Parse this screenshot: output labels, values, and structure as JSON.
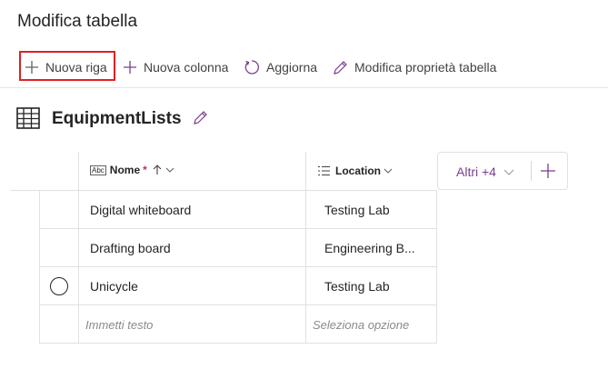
{
  "page": {
    "title": "Modifica tabella"
  },
  "toolbar": {
    "new_row": "Nuova riga",
    "new_column": "Nuova colonna",
    "refresh": "Aggiorna",
    "edit_props": "Modifica proprietà tabella"
  },
  "table": {
    "name": "EquipmentLists",
    "columns": [
      {
        "label": "Nome",
        "required_mark": "*",
        "type_icon": "text-type-icon",
        "type_text": "Abc"
      },
      {
        "label": "Location",
        "type_icon": "choice-type-icon"
      }
    ],
    "more_columns": "Altri +4",
    "rows": [
      {
        "name": "Digital whiteboard",
        "location": "Testing Lab"
      },
      {
        "name": "Drafting board",
        "location": "Engineering B..."
      },
      {
        "name": "Unicycle",
        "location": "Testing Lab"
      }
    ],
    "new_row_placeholders": {
      "name": "Immetti testo",
      "location": "Seleziona opzione"
    }
  },
  "colors": {
    "accent": "#7a3d8f",
    "highlight": "#e02020"
  }
}
